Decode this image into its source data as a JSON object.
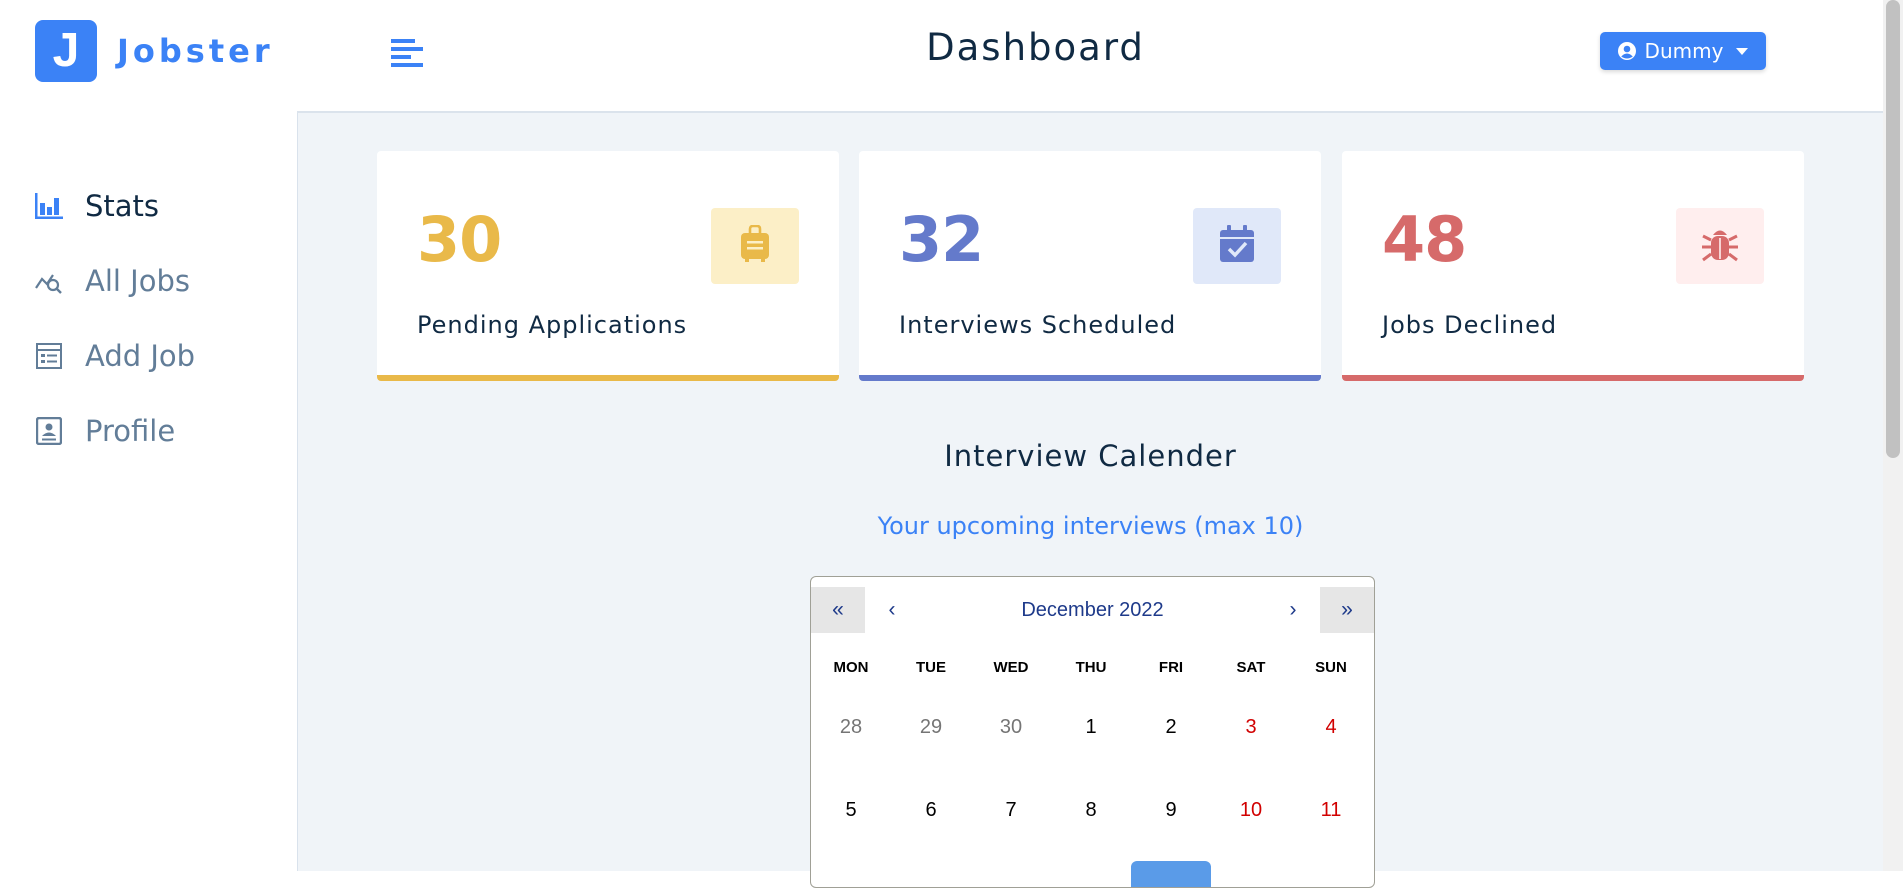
{
  "app": {
    "logo_letter": "J",
    "name": "Jobster",
    "brand_color": "#3b82f6"
  },
  "sidebar": {
    "items": [
      {
        "label": "Stats",
        "icon": "bar-chart-icon",
        "active": true
      },
      {
        "label": "All Jobs",
        "icon": "search-chart-icon",
        "active": false
      },
      {
        "label": "Add Job",
        "icon": "form-icon",
        "active": false
      },
      {
        "label": "Profile",
        "icon": "id-card-icon",
        "active": false
      }
    ]
  },
  "header": {
    "title": "Dashboard",
    "toggle_icon": "menu-align-left-icon",
    "user": {
      "name": "Dummy",
      "icon": "user-circle-icon",
      "caret_icon": "caret-down-icon"
    }
  },
  "stats": [
    {
      "count": "30",
      "label": "Pending Applications",
      "icon": "suitcase-icon",
      "color": "#e9b949",
      "bg": "#fcefc7"
    },
    {
      "count": "32",
      "label": "Interviews Scheduled",
      "icon": "calendar-check-icon",
      "color": "#647acb",
      "bg": "#e0e8f9"
    },
    {
      "count": "48",
      "label": "Jobs Declined",
      "icon": "bug-icon",
      "color": "#d66a6a",
      "bg": "#ffeeee"
    }
  ],
  "calendar_section": {
    "title": "Interview Calender",
    "subtitle": "Your upcoming interviews (max 10)"
  },
  "calendar": {
    "prev_year": "«",
    "prev_month": "‹",
    "month_label": "December 2022",
    "next_month": "›",
    "next_year": "»",
    "weekdays": [
      "MON",
      "TUE",
      "WED",
      "THU",
      "FRI",
      "SAT",
      "SUN"
    ],
    "days": [
      {
        "d": "28",
        "type": "neighbor"
      },
      {
        "d": "29",
        "type": "neighbor"
      },
      {
        "d": "30",
        "type": "neighbor"
      },
      {
        "d": "1",
        "type": "normal"
      },
      {
        "d": "2",
        "type": "normal"
      },
      {
        "d": "3",
        "type": "weekend"
      },
      {
        "d": "4",
        "type": "weekend"
      },
      {
        "d": "5",
        "type": "normal"
      },
      {
        "d": "6",
        "type": "normal"
      },
      {
        "d": "7",
        "type": "normal"
      },
      {
        "d": "8",
        "type": "normal"
      },
      {
        "d": "9",
        "type": "normal"
      },
      {
        "d": "10",
        "type": "weekend"
      },
      {
        "d": "11",
        "type": "weekend"
      }
    ]
  }
}
